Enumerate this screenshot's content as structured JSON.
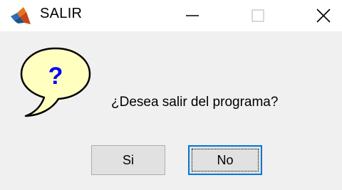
{
  "window": {
    "title": "SALIR",
    "app_icon": "matlab-icon",
    "controls": {
      "minimize": "minimize-icon",
      "maximize": "maximize-icon",
      "close": "close-icon"
    }
  },
  "dialog": {
    "icon": "question-icon",
    "icon_glyph": "?",
    "message": "¿Desea salir del programa?",
    "buttons": {
      "yes_label": "Si",
      "no_label": "No"
    },
    "focused_button": "No"
  },
  "colors": {
    "dialog_background": "#f0f0f0",
    "focus_border": "#0078d7",
    "question_bubble": "#ffffc0",
    "question_mark": "#0000ff"
  }
}
